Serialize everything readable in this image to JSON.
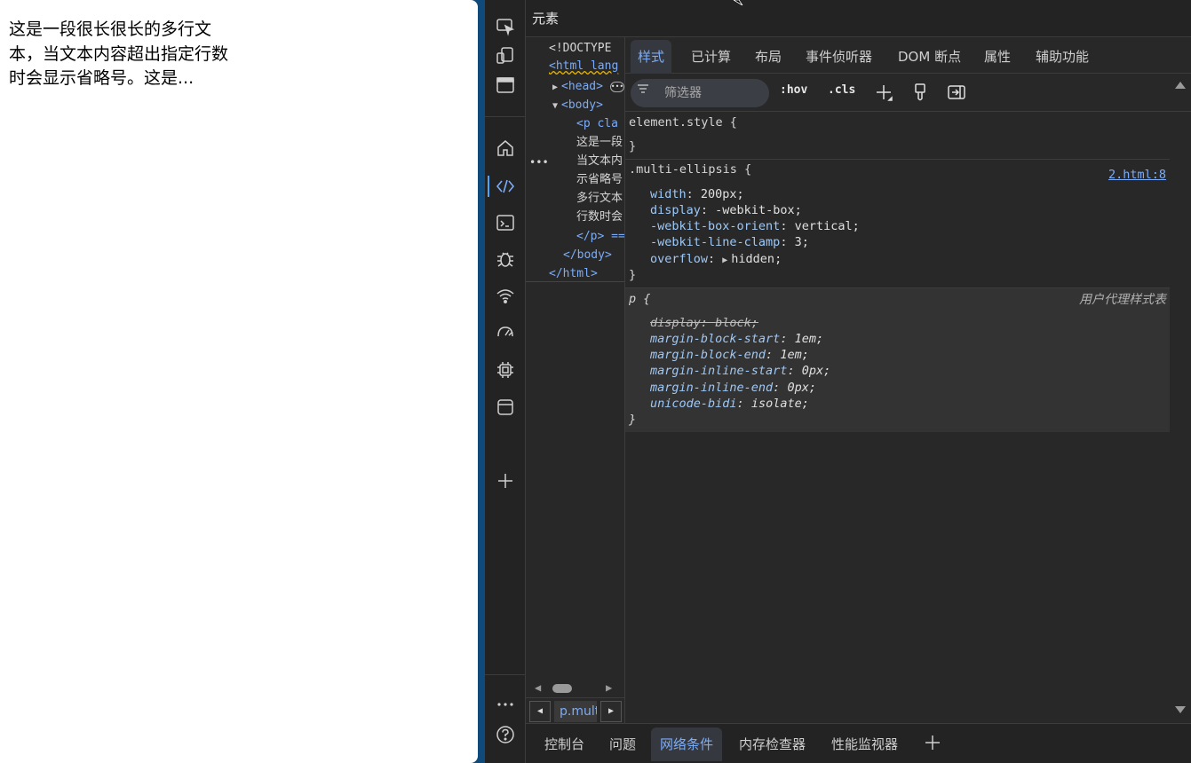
{
  "preview": {
    "text": "这是一段很长很长的多行文本，当文本内容超出指定行数时会显示省略号。这是..."
  },
  "devtools": {
    "title": "元素",
    "tabs": [
      {
        "label": "样式",
        "active": true
      },
      {
        "label": "已计算"
      },
      {
        "label": "布局"
      },
      {
        "label": "事件侦听器"
      },
      {
        "label": "DOM 断点"
      },
      {
        "label": "属性"
      },
      {
        "label": "辅助功能"
      }
    ],
    "toolbar": {
      "filter_placeholder": "筛选器",
      "hov": ":hov",
      "cls": ".cls"
    },
    "dom": {
      "doctype": "<!DOCTYPE",
      "html_open": "<html lang",
      "head": "<head>",
      "body_open": "<body>",
      "p_open": "<p cla",
      "p_text_lines": [
        "这是一段",
        "当文本内",
        "示省略号",
        "多行文本",
        "行数时会"
      ],
      "p_close": "</p> ==",
      "body_close": "</body>",
      "html_close": "</html>",
      "gutter": "•••",
      "breadcrumb": "p.multi-ellipsis"
    },
    "rules": {
      "element_style": {
        "selector": "element.style {",
        "close": "}"
      },
      "multi": {
        "selector": ".multi-ellipsis {",
        "source": "2.html:8",
        "props": [
          {
            "name": "width",
            "value": "200px;"
          },
          {
            "name": "display",
            "value": "-webkit-box;"
          },
          {
            "name": "-webkit-box-orient",
            "value": "vertical;"
          },
          {
            "name": "-webkit-line-clamp",
            "value": "3;"
          },
          {
            "name": "overflow",
            "value": "hidden;"
          }
        ],
        "close": "}"
      },
      "ua": {
        "selector": "p {",
        "source": "用户代理样式表",
        "props": [
          {
            "name": "display",
            "value": "block;",
            "overridden": true
          },
          {
            "name": "margin-block-start",
            "value": "1em;"
          },
          {
            "name": "margin-block-end",
            "value": "1em;"
          },
          {
            "name": "margin-inline-start",
            "value": "0px;"
          },
          {
            "name": "margin-inline-end",
            "value": "0px;"
          },
          {
            "name": "unicode-bidi",
            "value": "isolate;"
          }
        ],
        "close": "}"
      }
    },
    "drawer_tabs": [
      {
        "label": "控制台"
      },
      {
        "label": "问题"
      },
      {
        "label": "网络条件",
        "active": true
      },
      {
        "label": "内存检查器"
      },
      {
        "label": "性能监视器"
      }
    ],
    "activity_icons": [
      "inspect-icon",
      "device-toolbar-icon",
      "window-icon",
      "home-icon",
      "elements-icon",
      "console-icon",
      "sources-bug-icon",
      "network-wifi-icon",
      "performance-gauge-icon",
      "memory-chip-icon",
      "application-icon",
      "add-icon",
      "more-icon",
      "help-icon"
    ],
    "colors": {
      "accent": "#7cacf8",
      "background": "#282828",
      "page_frame": "#0f4a7a"
    }
  }
}
